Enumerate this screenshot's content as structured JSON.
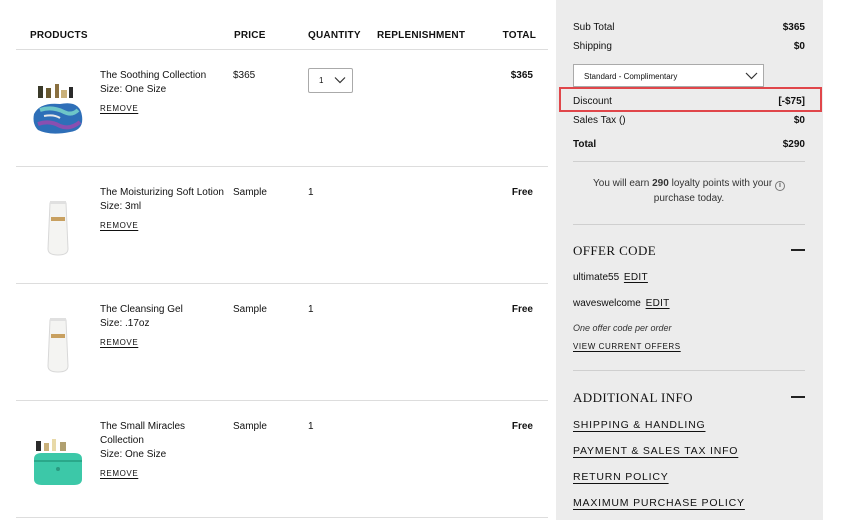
{
  "cart": {
    "headers": {
      "products": "PRODUCTS",
      "price": "PRICE",
      "quantity": "QUANTITY",
      "replenishment": "REPLENISHMENT",
      "total": "TOTAL"
    },
    "items": [
      {
        "name": "The Soothing Collection",
        "size": "Size: One Size",
        "remove": "REMOVE",
        "price": "$365",
        "quantity": "1",
        "total": "$365"
      },
      {
        "name": "The Moisturizing Soft Lotion",
        "size": "Size: 3ml",
        "remove": "REMOVE",
        "price": "Sample",
        "quantity": "1",
        "total": "Free"
      },
      {
        "name": "The Cleansing Gel",
        "size": "Size: .17oz",
        "remove": "REMOVE",
        "price": "Sample",
        "quantity": "1",
        "total": "Free"
      },
      {
        "name": "The Small Miracles Collection",
        "size": "Size: One Size",
        "remove": "REMOVE",
        "price": "Sample",
        "quantity": "1",
        "total": "Free"
      }
    ]
  },
  "summary": {
    "subtotal_label": "Sub Total",
    "subtotal": "$365",
    "shipping_label": "Shipping",
    "shipping": "$0",
    "shipping_method": "Standard - Complimentary",
    "discount_label": "Discount",
    "discount": "[-$75]",
    "tax_label": "Sales Tax ()",
    "tax": "$0",
    "total_label": "Total",
    "total": "$290",
    "loyalty_pre": "You will earn ",
    "loyalty_points": "290",
    "loyalty_post": " loyalty points with your",
    "loyalty_line2": "purchase today.",
    "highlight_color": "#e0464a"
  },
  "offer": {
    "title": "OFFER CODE",
    "codes": [
      {
        "code": "ultimate55",
        "edit": "EDIT"
      },
      {
        "code": "waveswelcome",
        "edit": "EDIT"
      }
    ],
    "note": "One offer code per order",
    "view_offers": "VIEW CURRENT OFFERS"
  },
  "additional": {
    "title": "ADDITIONAL INFO",
    "links": [
      "SHIPPING & HANDLING",
      "PAYMENT & SALES TAX INFO",
      "RETURN POLICY",
      "MAXIMUM PURCHASE POLICY"
    ]
  }
}
